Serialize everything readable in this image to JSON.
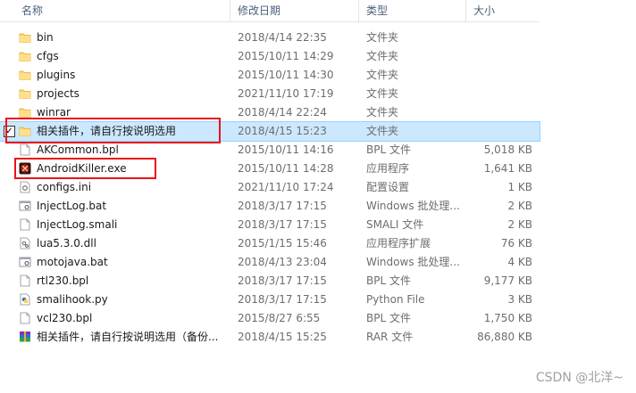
{
  "columns": {
    "name": "名称",
    "date": "修改日期",
    "type": "类型",
    "size": "大小"
  },
  "rows": [
    {
      "name": "bin",
      "date": "2018/4/14 22:35",
      "type": "文件夹",
      "size": "",
      "icon": "folder-icon"
    },
    {
      "name": "cfgs",
      "date": "2015/10/11 14:29",
      "type": "文件夹",
      "size": "",
      "icon": "folder-icon"
    },
    {
      "name": "plugins",
      "date": "2015/10/11 14:30",
      "type": "文件夹",
      "size": "",
      "icon": "folder-icon"
    },
    {
      "name": "projects",
      "date": "2021/11/10 17:19",
      "type": "文件夹",
      "size": "",
      "icon": "folder-icon"
    },
    {
      "name": "winrar",
      "date": "2018/4/14 22:24",
      "type": "文件夹",
      "size": "",
      "icon": "folder-icon"
    },
    {
      "name": "相关插件，请自行按说明选用",
      "date": "2018/4/15 15:23",
      "type": "文件夹",
      "size": "",
      "icon": "folder-icon",
      "selected": true
    },
    {
      "name": "AKCommon.bpl",
      "date": "2015/10/11 14:16",
      "type": "BPL 文件",
      "size": "5,018 KB",
      "icon": "bpl-file-icon"
    },
    {
      "name": "AndroidKiller.exe",
      "date": "2015/10/11 14:28",
      "type": "应用程序",
      "size": "1,641 KB",
      "icon": "androidkiller-app-icon"
    },
    {
      "name": "configs.ini",
      "date": "2021/11/10 17:24",
      "type": "配置设置",
      "size": "1 KB",
      "icon": "ini-file-icon"
    },
    {
      "name": "InjectLog.bat",
      "date": "2018/3/17 17:15",
      "type": "Windows 批处理...",
      "size": "2 KB",
      "icon": "bat-file-icon"
    },
    {
      "name": "InjectLog.smali",
      "date": "2018/3/17 17:15",
      "type": "SMALI 文件",
      "size": "2 KB",
      "icon": "smali-file-icon"
    },
    {
      "name": "lua5.3.0.dll",
      "date": "2015/1/15 15:46",
      "type": "应用程序扩展",
      "size": "76 KB",
      "icon": "dll-file-icon"
    },
    {
      "name": "motojava.bat",
      "date": "2018/4/13 23:04",
      "type": "Windows 批处理...",
      "size": "4 KB",
      "icon": "bat-file-icon"
    },
    {
      "name": "rtl230.bpl",
      "date": "2018/3/17 17:15",
      "type": "BPL 文件",
      "size": "9,177 KB",
      "icon": "bpl-file-icon"
    },
    {
      "name": "smalihook.py",
      "date": "2018/3/17 17:15",
      "type": "Python File",
      "size": "3 KB",
      "icon": "python-file-icon"
    },
    {
      "name": "vcl230.bpl",
      "date": "2015/8/27 6:55",
      "type": "BPL 文件",
      "size": "1,750 KB",
      "icon": "bpl-file-icon"
    },
    {
      "name": "相关插件，请自行按说明选用（备份...",
      "date": "2018/4/15 15:25",
      "type": "RAR 文件",
      "size": "86,880 KB",
      "icon": "rar-archive-icon"
    }
  ],
  "checkbox_mark": "✓",
  "watermark": "CSDN @北洋~"
}
